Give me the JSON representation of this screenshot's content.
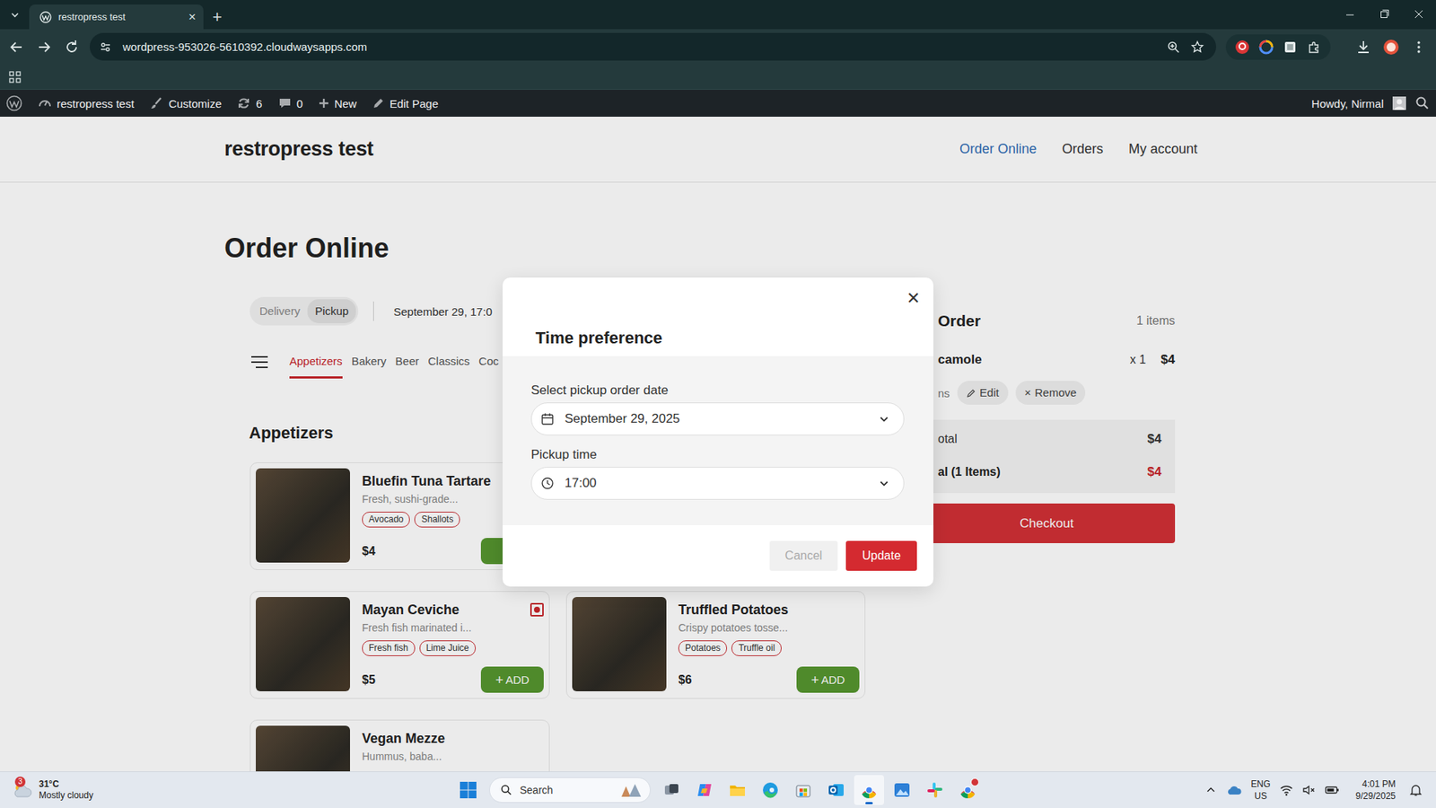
{
  "browser": {
    "tabs": [
      {
        "title": "restropress test",
        "selected": true
      }
    ],
    "close_tab": "×",
    "new_tab": "+",
    "url": "wordpress-953026-5610392.cloudwaysapps.com"
  },
  "admin_bar": {
    "site": "restropress test",
    "customize": "Customize",
    "updates": "6",
    "comments": "0",
    "new": "New",
    "edit": "Edit Page",
    "greeting": "Howdy, Nirmal"
  },
  "site": {
    "title": "restropress test",
    "nav": [
      {
        "label": "Order Online",
        "selected": true
      },
      {
        "label": "Orders",
        "selected": false
      },
      {
        "label": "My account",
        "selected": false
      }
    ]
  },
  "page": {
    "title": "Order Online",
    "modes": [
      {
        "label": "Delivery",
        "selected": false
      },
      {
        "label": "Pickup",
        "selected": true
      }
    ],
    "when": "September 29, 17:0",
    "categories": [
      {
        "label": "Appetizers",
        "selected": true
      },
      {
        "label": "Bakery",
        "selected": false
      },
      {
        "label": "Beer",
        "selected": false
      },
      {
        "label": "Classics",
        "selected": false
      },
      {
        "label": "Coc",
        "selected": false
      }
    ],
    "section": "Appetizers",
    "items": [
      {
        "kind": "dish",
        "name": "Bluefin Tuna Tartare",
        "description": "Fresh, sushi-grade...",
        "tags": [
          "Avocado",
          "Shallots"
        ],
        "price": "$4",
        "add_icon": "+",
        "marker": false
      },
      {
        "kind": "hidden"
      },
      {
        "kind": "dish",
        "name": "Mayan Ceviche",
        "description": "Fresh fish marinated i...",
        "tags": [
          "Fresh fish",
          "Lime Juice"
        ],
        "price": "$5",
        "add_icon": "+",
        "add_label": "ADD",
        "marker": true
      },
      {
        "kind": "dish",
        "name": "Truffled Potatoes",
        "description": "Crispy potatoes tosse...",
        "tags": [
          "Potatoes",
          "Truffle oil"
        ],
        "price": "$6",
        "add_icon": "+",
        "add_label": "ADD",
        "marker": false
      },
      {
        "kind": "dish",
        "name": "Vegan Mezze",
        "description": "Hummus, baba...",
        "tags": [],
        "marker": false
      }
    ]
  },
  "cart": {
    "title": "Order",
    "count": "1 items",
    "lines": [
      {
        "name": "camole",
        "qty": "x 1",
        "price": "$4",
        "options": "ns",
        "edit": "Edit",
        "remove_icon": "×",
        "remove": "Remove"
      }
    ],
    "subtotal": {
      "label": "otal",
      "value": "$4"
    },
    "total": {
      "label": "al (1 Items)",
      "value": "$4"
    },
    "checkout": "Checkout"
  },
  "modal": {
    "title": "Time preference",
    "close": "✕",
    "date_label": "Select pickup order date",
    "date": "September 29, 2025",
    "time_label": "Pickup time",
    "time": "17:00",
    "cancel": "Cancel",
    "update": "Update"
  },
  "taskbar": {
    "weather": {
      "temp": "31°C",
      "condition": "Mostly cloudy",
      "badge": "3"
    },
    "search": "Search",
    "apps": [
      {
        "kind": "taskview",
        "active": false,
        "badge": false
      },
      {
        "kind": "copilot",
        "active": false,
        "badge": false
      },
      {
        "kind": "explorer",
        "active": false,
        "badge": false
      },
      {
        "kind": "edge",
        "active": false,
        "badge": false
      },
      {
        "kind": "store",
        "active": false,
        "badge": false
      },
      {
        "kind": "outlook",
        "active": false,
        "badge": false
      },
      {
        "kind": "chrome",
        "active": true,
        "badge": false
      },
      {
        "kind": "photos",
        "active": false,
        "badge": false
      },
      {
        "kind": "slack",
        "active": false,
        "badge": false
      },
      {
        "kind": "chrome",
        "active": false,
        "badge": true
      }
    ],
    "lang": "ENG",
    "region": "US",
    "time": "4:01 PM",
    "date": "9/29/2025"
  }
}
